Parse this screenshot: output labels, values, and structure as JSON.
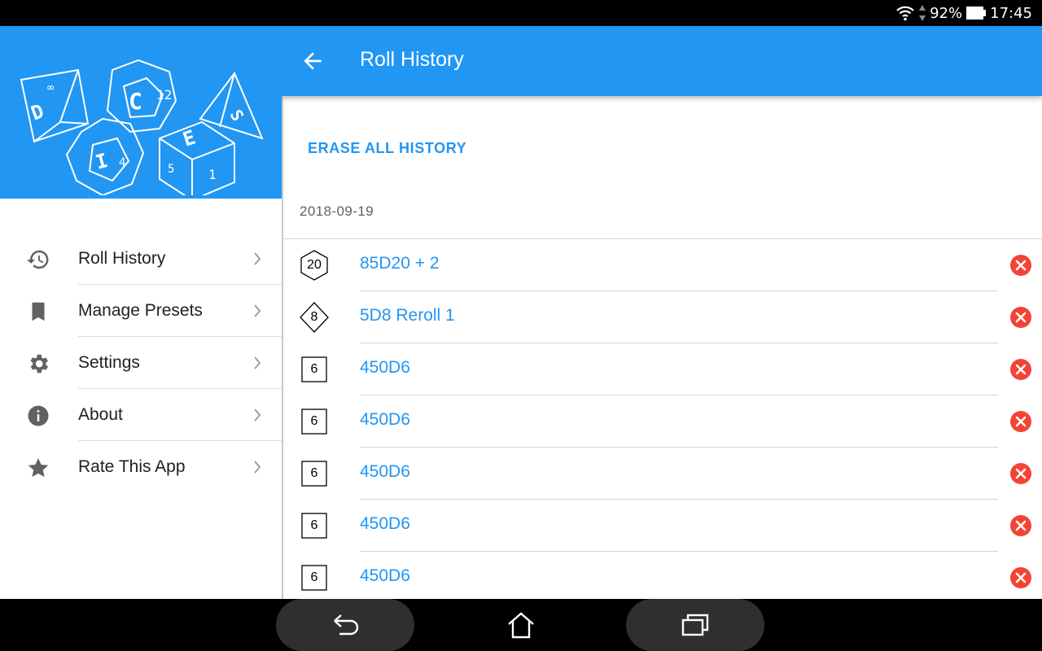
{
  "status_bar": {
    "battery": "92%",
    "time": "17:45",
    "icons": [
      "wifi-icon",
      "signal-arrows-icon",
      "battery-icon"
    ]
  },
  "drawer": {
    "header_logo_letters": [
      "D",
      "I",
      "C",
      "E",
      "S"
    ],
    "menu": [
      {
        "label": "Roll History",
        "icon": "history-icon"
      },
      {
        "label": "Manage Presets",
        "icon": "bookmark-icon"
      },
      {
        "label": "Settings",
        "icon": "gear-icon"
      },
      {
        "label": "About",
        "icon": "info-icon"
      },
      {
        "label": "Rate This App",
        "icon": "star-icon"
      }
    ]
  },
  "app_bar": {
    "title": "Roll History",
    "back_icon": "arrow-back-icon"
  },
  "content": {
    "erase_label": "ERASE ALL HISTORY",
    "date": "2018-09-19",
    "rolls": [
      {
        "die": "20",
        "shape": "hexagon",
        "label": "85D20 + 2"
      },
      {
        "die": "8",
        "shape": "diamond",
        "label": "5D8 Reroll 1"
      },
      {
        "die": "6",
        "shape": "square",
        "label": "450D6"
      },
      {
        "die": "6",
        "shape": "square",
        "label": "450D6"
      },
      {
        "die": "6",
        "shape": "square",
        "label": "450D6"
      },
      {
        "die": "6",
        "shape": "square",
        "label": "450D6"
      },
      {
        "die": "6",
        "shape": "square",
        "label": "450D6"
      }
    ]
  },
  "colors": {
    "primary": "#2196F3",
    "delete": "#F44336",
    "text": "#212121",
    "muted_icon": "#616161"
  },
  "nav_bar": {
    "icons": [
      "nav-back-icon",
      "nav-home-icon",
      "nav-recents-icon"
    ]
  }
}
